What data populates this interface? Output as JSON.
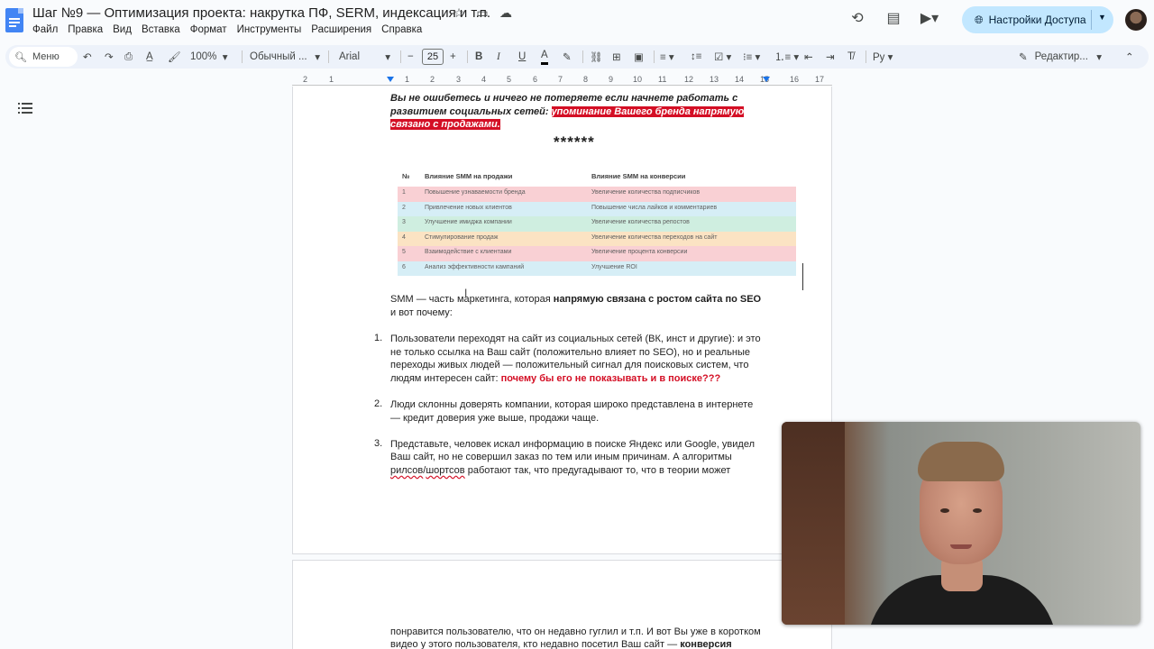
{
  "app": {
    "doc_title": "Шаг №9 — Оптимизация проекта: накрутка ПФ, SERM, индексация и т.п.",
    "menu": [
      "Файл",
      "Правка",
      "Вид",
      "Вставка",
      "Формат",
      "Инструменты",
      "Расширения",
      "Справка"
    ],
    "share_label": "Настройки Доступа",
    "colors": {
      "accent": "#c2e7ff",
      "highlight_red": "#d40f25",
      "doc_blue": "#4285f4"
    }
  },
  "toolbar": {
    "search_label": "Меню",
    "zoom": "100%",
    "style": "Обычный ...",
    "font": "Arial",
    "font_size": "25",
    "mode": "Редактир..."
  },
  "ruler": [
    "2",
    "1",
    "1",
    "2",
    "3",
    "4",
    "5",
    "6",
    "7",
    "8",
    "9",
    "10",
    "11",
    "12",
    "13",
    "14",
    "15",
    "16",
    "17",
    "18"
  ],
  "doc": {
    "intro_line1": "Вы не ошибетесь и ничего не потеряете если начнете работать с",
    "intro_line2_a": "развитием социальных сетей: ",
    "intro_line2_b": "упоминание Вашего бренда напрямую",
    "intro_line3": "связано с продажами.",
    "stars": "******",
    "table": {
      "headers": [
        "№",
        "Влияние SMM на продажи",
        "Влияние SMM на конверсии"
      ],
      "rows": [
        {
          "n": "1",
          "sales": "Повышение узнаваемости бренда",
          "conv": "Увеличение количества подписчиков",
          "color": "#f9d0d4"
        },
        {
          "n": "2",
          "sales": "Привлечение новых клиентов",
          "conv": "Повышение числа лайков и комментариев",
          "color": "#d6eef6"
        },
        {
          "n": "3",
          "sales": "Улучшение имиджа компании",
          "conv": "Увеличение количества репостов",
          "color": "#cfeee0"
        },
        {
          "n": "4",
          "sales": "Стимулирование продаж",
          "conv": "Увеличение количества переходов на сайт",
          "color": "#fbe3c3"
        },
        {
          "n": "5",
          "sales": "Взаимодействие с клиентами",
          "conv": "Увеличение процента конверсии",
          "color": "#f9d0d4"
        },
        {
          "n": "6",
          "sales": "Анализ эффективности кампаний",
          "conv": "Улучшение ROI",
          "color": "#d6eef6"
        }
      ]
    },
    "smm_a": "SMM — часть маркетинга, которая ",
    "smm_b": "напрямую связана с ростом сайта по SEO",
    "smm_c": "и вот почему:",
    "list": [
      {
        "n": "1.",
        "l1": "Пользователи переходят на сайт из социальных сетей (ВК, инст и другие): и это",
        "l2": "не только ссылка на Ваш сайт (положительно влияет по SEO), но и реальные",
        "l3": "переходы живых людей — положительный сигнал для поисковых систем, что",
        "l4a": "людям интересен сайт: ",
        "l4b": "почему бы его не показывать и в поиске???"
      },
      {
        "n": "2.",
        "l1": "Люди склонны доверять компании, которая широко представлена в интернете",
        "l2": "— кредит доверия уже выше, продажи чаще."
      },
      {
        "n": "3.",
        "l1": "Представьте, человек искал информацию в поиске Яндекс или Google, увидел",
        "l2": "Ваш сайт, но не совершил заказ по тем или иным причинам. А алгоритмы",
        "l3a": "рилсов",
        "l3b": "/",
        "l3c": "шортсов",
        "l3d": " работают так, что предугадывают то, что в теории может"
      }
    ],
    "p2_l1": "понравится пользователю, что он недавно гуглил и т.п. И вот Вы уже в коротком",
    "p2_l2a": "видео у этого пользователя, кто недавно посетил Ваш сайт — ",
    "p2_l2b": "конверсия"
  }
}
